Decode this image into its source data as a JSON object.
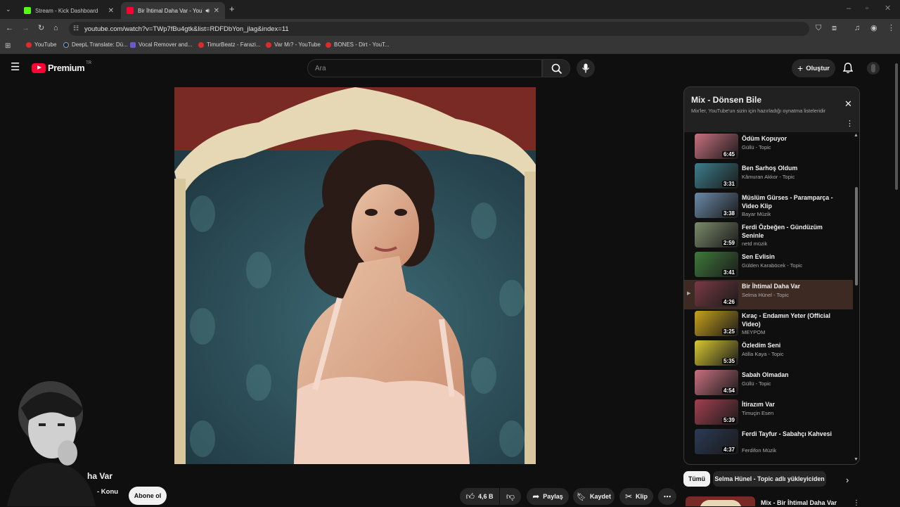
{
  "browser": {
    "tabs": [
      {
        "title": "Stream - Kick Dashboard",
        "color": "#53fc18"
      },
      {
        "title": "Bir İhtimal Daha Var - YouTube",
        "color": "#ff0033"
      }
    ],
    "url": "youtube.com/watch?v=TWp7fBu4gtk&list=RDFDbYon_jlag&index=11",
    "bookmarks": [
      "YouTube",
      "DeepL Translate: Dü...",
      "Vocal Remover and...",
      "TimurBeatz - Farazi...",
      "Var Mı? - YouTube",
      "BONES - Dirt - YouT..."
    ]
  },
  "masthead": {
    "logo": "Premium",
    "region": "TR",
    "search_placeholder": "Ara",
    "create_label": "Oluştur"
  },
  "playlist": {
    "title": "Mix - Dönsen Bile",
    "subtitle": "Mix'ler, YouTube'un sizin için hazırladığı oynatma listeleridir",
    "items": [
      {
        "title": "Ödüm Kopuyor",
        "channel": "Güllü - Topic",
        "duration": "6:45",
        "color": "#c9707e"
      },
      {
        "title": "Ben Sarhoş Oldum",
        "channel": "Kâmuran Akkor - Topic",
        "duration": "3:31",
        "color": "#3c7e8c"
      },
      {
        "title": "Müslüm Gürses - Paramparça - Video Klip",
        "channel": "Bayar Müzik",
        "duration": "3:38",
        "color": "#6a8aa8"
      },
      {
        "title": "Ferdi Özbeğen - Gündüzüm Seninle",
        "channel": "netd müzik",
        "duration": "2:59",
        "color": "#7a8a6a"
      },
      {
        "title": "Sen Evlisin",
        "channel": "Gülden Karaböcek - Topic",
        "duration": "3:41",
        "color": "#3f7a3a"
      },
      {
        "title": "Bir İhtimal Daha Var",
        "channel": "Selma Hünel - Topic",
        "duration": "4:26",
        "color": "#7a3a44"
      },
      {
        "title": "Kıraç - Endamın Yeter (Official Video)",
        "channel": "MEYPOM",
        "duration": "3:25",
        "color": "#c9a21a"
      },
      {
        "title": "Özledim Seni",
        "channel": "Atilla Kaya - Topic",
        "duration": "5:35",
        "color": "#d8c830"
      },
      {
        "title": "Sabah Olmadan",
        "channel": "Güllü - Topic",
        "duration": "4:54",
        "color": "#c9707e"
      },
      {
        "title": "İtirazım Var",
        "channel": "Timuçin Esen",
        "duration": "5:39",
        "color": "#a34050"
      },
      {
        "title": "Ferdi Tayfur - Sabahçı Kahvesi",
        "channel": "Ferdifon Müzik",
        "duration": "4:37",
        "color": "#2a3a55"
      }
    ],
    "current_index": 5
  },
  "video_meta": {
    "title_fragment": "ha Var",
    "channel_fragment": "- Konu",
    "subscribe_label": "Abone ol",
    "like_count": "4,6 B",
    "share_label": "Paylaş",
    "save_label": "Kaydet",
    "clip_label": "Klip"
  },
  "chips": [
    "Tümü",
    "Selma Hünel - Topic adlı yükleyiciden"
  ],
  "next_video": {
    "title": "Mix - Bir İhtimal Daha Var"
  }
}
